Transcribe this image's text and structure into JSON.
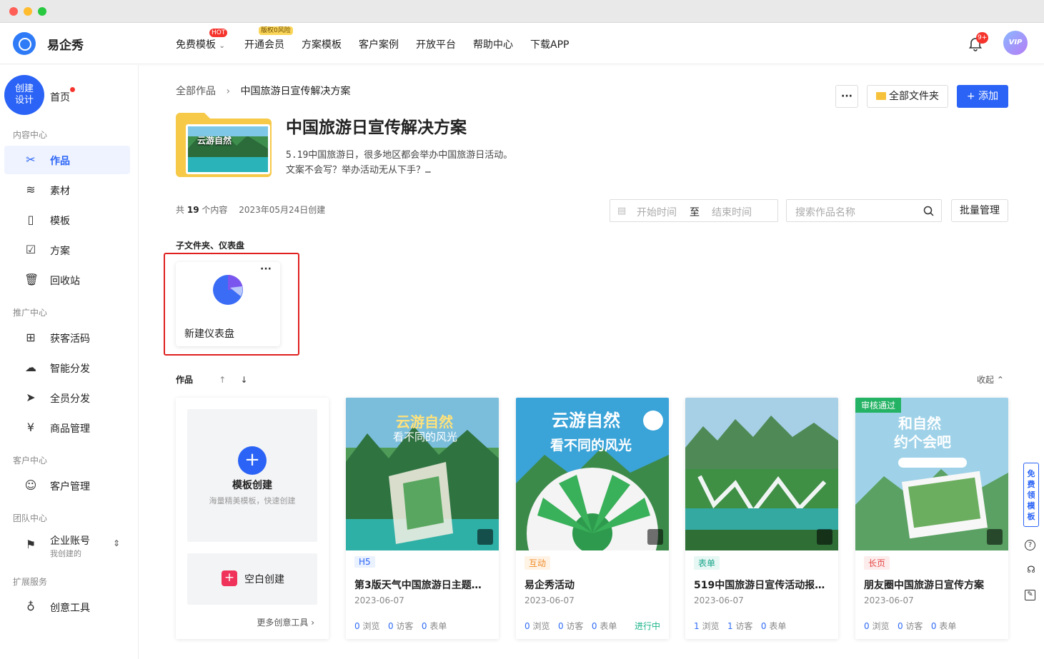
{
  "app": {
    "name": "易企秀"
  },
  "nav": {
    "items": [
      {
        "label": "免费模板",
        "badge": "HOT"
      },
      {
        "label": "开通会员",
        "badge": "版权0风险"
      },
      {
        "label": "方案模板"
      },
      {
        "label": "客户案例"
      },
      {
        "label": "开放平台"
      },
      {
        "label": "帮助中心"
      },
      {
        "label": "下载APP"
      }
    ],
    "notify_badge": "9+",
    "vip_label": "VIP"
  },
  "sidebar": {
    "create_label_1": "创建",
    "create_label_2": "设计",
    "home": "首页",
    "sections": {
      "content": "内容中心",
      "promo": "推广中心",
      "customer": "客户中心",
      "team": "团队中心",
      "ext": "扩展服务"
    },
    "items": {
      "works": "作品",
      "material": "素材",
      "template": "模板",
      "plan": "方案",
      "recycle": "回收站",
      "qrcode": "获客活码",
      "smart": "智能分发",
      "staff": "全员分发",
      "goods": "商品管理",
      "cust": "客户管理",
      "account": "企业账号",
      "account_sub": "我创建的",
      "tools": "创意工具"
    }
  },
  "breadcrumb": {
    "root": "全部作品",
    "current": "中国旅游日宣传解决方案"
  },
  "actions": {
    "more": "···",
    "all_folders": "全部文件夹",
    "add": "+ 添加"
  },
  "folder": {
    "title": "中国旅游日宣传解决方案",
    "desc_1": "5.19中国旅游日，很多地区都会举办中国旅游日活动。",
    "desc_2": "文案不会写？举办活动无从下手？…",
    "count_prefix": "共",
    "count": "19",
    "count_suffix": "个内容",
    "created": "2023年05月24日创建",
    "thumb_text": "云游自然"
  },
  "filters": {
    "start": "开始时间",
    "to": "至",
    "end": "结束时间",
    "search_placeholder": "搜索作品名称",
    "batch": "批量管理"
  },
  "subfolders": {
    "heading": "子文件夹、仪表盘",
    "dashboard_label": "新建仪表盘",
    "dots": "···"
  },
  "works": {
    "heading": "作品",
    "collapse": "收起",
    "new_card": {
      "template_title": "模板创建",
      "template_sub": "海量精美模板，快速创建",
      "blank": "空白创建",
      "more_tools": "更多创意工具 ›"
    },
    "cards": [
      {
        "tag": "H5",
        "title": "第3版天气中国旅游日主题…",
        "date": "2023-06-07",
        "views": "0",
        "visitors": "0",
        "forms": "0",
        "status": "",
        "badge": "",
        "thumb_title": "云游自然",
        "thumb_sub": "看不同的风光"
      },
      {
        "tag": "互动",
        "title": "易企秀活动",
        "date": "2023-06-07",
        "views": "0",
        "visitors": "0",
        "forms": "0",
        "status": "进行中",
        "badge": "",
        "thumb_title": "云游自然",
        "thumb_sub": "看不同的风光"
      },
      {
        "tag": "表单",
        "title": "519中国旅游日宣传活动报…",
        "date": "2023-06-07",
        "views": "1",
        "visitors": "1",
        "forms": "0",
        "status": "",
        "badge": "",
        "thumb_title": "",
        "thumb_sub": ""
      },
      {
        "tag": "长页",
        "title": "朋友圈中国旅游日宣传方案",
        "date": "2023-06-07",
        "views": "0",
        "visitors": "0",
        "forms": "0",
        "status": "",
        "badge": "审核通过",
        "thumb_title": "和自然",
        "thumb_sub": "约个会吧"
      }
    ],
    "stat_labels": {
      "views": "浏览",
      "visitors": "访客",
      "forms": "表单"
    }
  },
  "float_panel": {
    "label": "免费领模板"
  }
}
